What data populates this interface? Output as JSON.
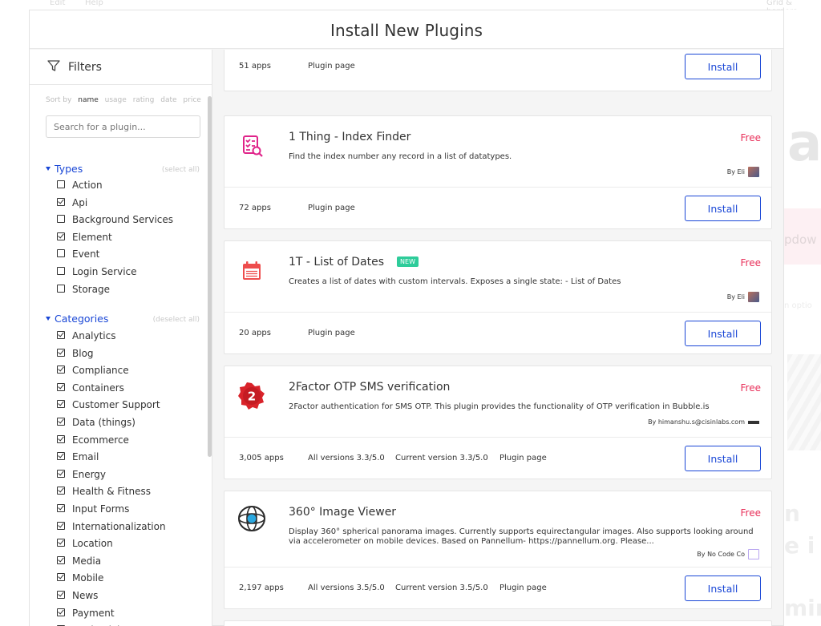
{
  "background": {
    "menu": [
      "Edit",
      "Help"
    ],
    "right_labels": [
      "Grid & borders"
    ],
    "side_fragments": [
      "a",
      "pdow",
      "n optio",
      "n",
      "e i",
      "min"
    ]
  },
  "modal": {
    "title": "Install New Plugins"
  },
  "filters": {
    "label": "Filters",
    "sort_by_label": "Sort by",
    "sort_options": [
      "name",
      "usage",
      "rating",
      "date",
      "price"
    ],
    "sort_active": "name",
    "search_placeholder": "Search for a plugin...",
    "types": {
      "label": "Types",
      "action": "(select all)",
      "items": [
        {
          "label": "Action",
          "checked": false
        },
        {
          "label": "Api",
          "checked": true
        },
        {
          "label": "Background Services",
          "checked": false
        },
        {
          "label": "Element",
          "checked": true
        },
        {
          "label": "Event",
          "checked": false
        },
        {
          "label": "Login Service",
          "checked": false
        },
        {
          "label": "Storage",
          "checked": false
        }
      ]
    },
    "categories": {
      "label": "Categories",
      "action": "(deselect all)",
      "items": [
        {
          "label": "Analytics",
          "checked": true
        },
        {
          "label": "Blog",
          "checked": true
        },
        {
          "label": "Compliance",
          "checked": true
        },
        {
          "label": "Containers",
          "checked": true
        },
        {
          "label": "Customer Support",
          "checked": true
        },
        {
          "label": "Data (things)",
          "checked": true
        },
        {
          "label": "Ecommerce",
          "checked": true
        },
        {
          "label": "Email",
          "checked": true
        },
        {
          "label": "Energy",
          "checked": true
        },
        {
          "label": "Health & Fitness",
          "checked": true
        },
        {
          "label": "Input Forms",
          "checked": true
        },
        {
          "label": "Internationalization",
          "checked": true
        },
        {
          "label": "Location",
          "checked": true
        },
        {
          "label": "Media",
          "checked": true
        },
        {
          "label": "Mobile",
          "checked": true
        },
        {
          "label": "News",
          "checked": true
        },
        {
          "label": "Payment",
          "checked": true
        },
        {
          "label": "Productivity",
          "checked": true
        }
      ]
    }
  },
  "plugins": [
    {
      "partial": true,
      "apps": "51 apps",
      "plugin_page": "Plugin page",
      "install": "Install"
    },
    {
      "name": "1 Thing - Index Finder",
      "price": "Free",
      "description": "Find the index number any record in a list of datatypes.",
      "by": "By Eli",
      "icon": "index-finder-icon",
      "icon_color": "#e0248a",
      "apps": "72 apps",
      "plugin_page": "Plugin page",
      "install": "Install"
    },
    {
      "name": "1T - List of Dates",
      "badge": "NEW",
      "price": "Free",
      "description": "Creates a list of dates with custom intervals. Exposes a single state: - List of Dates",
      "by": "By Eli",
      "icon": "calendar-icon",
      "icon_color": "#ee4d4d",
      "apps": "20 apps",
      "plugin_page": "Plugin page",
      "install": "Install"
    },
    {
      "name": "2Factor OTP SMS verification",
      "price": "Free",
      "description": "2Factor authentication for SMS OTP. This plugin provides the functionality of OTP verification in Bubble.is",
      "by": "By himanshu.s@cisinlabs.com",
      "icon": "number-two-badge-icon",
      "icon_color": "#d9232a",
      "apps": "3,005 apps",
      "all_versions": "All versions 3.3/5.0",
      "current_version": "Current version 3.3/5.0",
      "plugin_page": "Plugin page",
      "install": "Install"
    },
    {
      "name": "360° Image Viewer",
      "price": "Free",
      "description": "Display 360° spherical panorama images. Currently supports equirectangular images. Also supports looking around via accelerometer on mobile devices. Based on Pannellum- https://pannellum.org. Please...",
      "by": "By No Code Co",
      "icon": "globe-viewer-icon",
      "icon_color": "#2a2a2a",
      "apps": "2,197 apps",
      "all_versions": "All versions 3.5/5.0",
      "current_version": "Current version 3.5/5.0",
      "plugin_page": "Plugin page",
      "install": "Install"
    }
  ],
  "colors": {
    "accent": "#1a47d6",
    "free": "#e8305a",
    "new_badge": "#2ecc9a"
  }
}
